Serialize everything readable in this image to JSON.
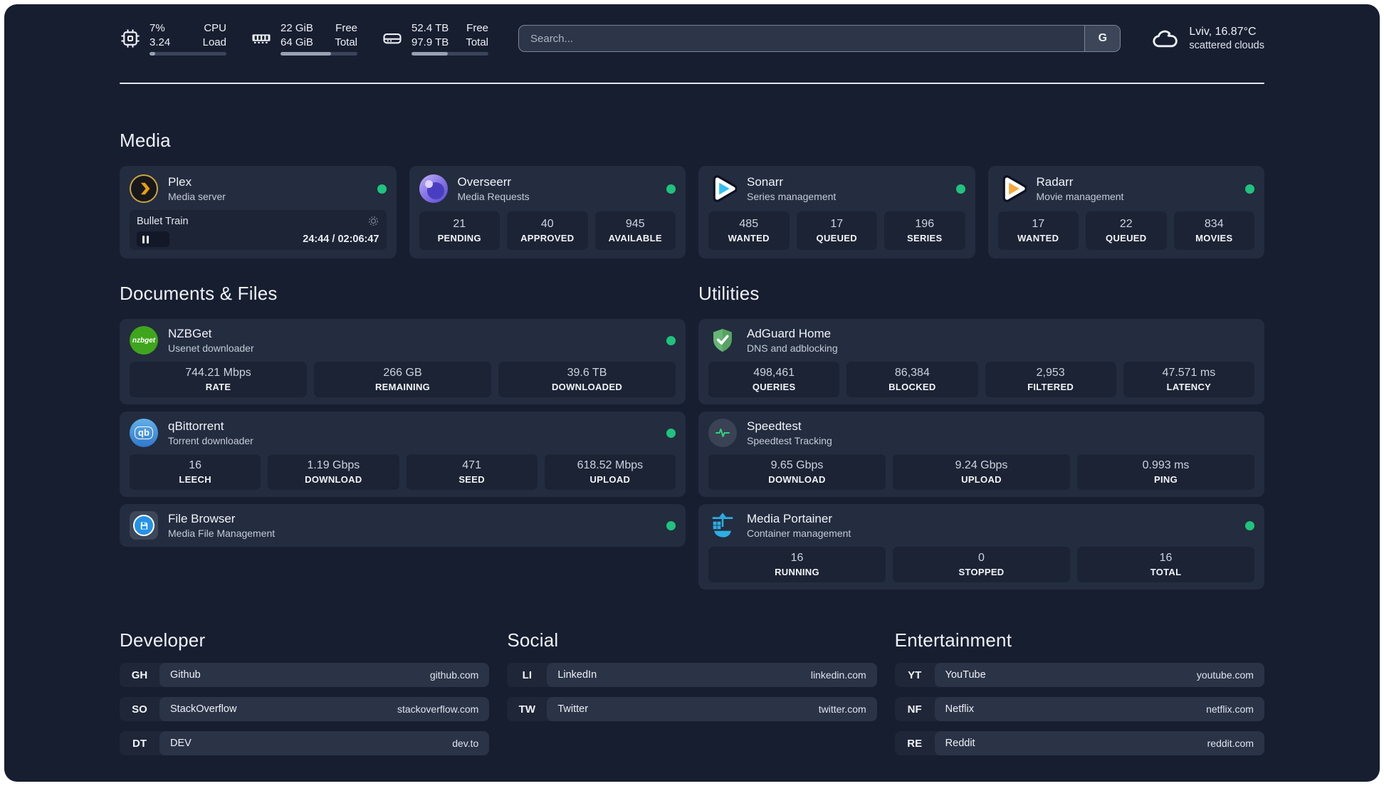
{
  "colors": {
    "status_online": "#1fc37d",
    "accent_plex": "#e8a00c",
    "accent_sonarr": "#31c1f2",
    "accent_radarr": "#f6a83a",
    "accent_nzbget": "#3fa51c",
    "accent_filebrowser": "#2492e8",
    "accent_adguard": "#66b574",
    "accent_speedtest": "#2ed47f",
    "accent_portainer": "#2caee4"
  },
  "topbar": {
    "cpu": {
      "value_top": "7%",
      "value_bottom": "3.24",
      "label_top": "CPU",
      "label_bottom": "Load",
      "progress_style": "width:7%"
    },
    "memory": {
      "value_top": "22 GiB",
      "value_bottom": "64 GiB",
      "label_top": "Free",
      "label_bottom": "Total",
      "progress_style": "width:66%"
    },
    "disk": {
      "value_top": "52.4 TB",
      "value_bottom": "97.9 TB",
      "label_top": "Free",
      "label_bottom": "Total",
      "progress_style": "width:47%"
    },
    "search": {
      "placeholder": "Search...",
      "button_label": "G"
    },
    "weather": {
      "location": "Lviv, 16.87°C",
      "condition": "scattered clouds"
    }
  },
  "media": {
    "title": "Media",
    "plex": {
      "title": "Plex",
      "subtitle": "Media server",
      "player": {
        "track": "Bullet Train",
        "time": "24:44 / 02:06:47"
      }
    },
    "overseerr": {
      "title": "Overseerr",
      "subtitle": "Media Requests",
      "stats": [
        {
          "value": "21",
          "label": "PENDING"
        },
        {
          "value": "40",
          "label": "APPROVED"
        },
        {
          "value": "945",
          "label": "AVAILABLE"
        }
      ]
    },
    "sonarr": {
      "title": "Sonarr",
      "subtitle": "Series management",
      "stats": [
        {
          "value": "485",
          "label": "WANTED"
        },
        {
          "value": "17",
          "label": "QUEUED"
        },
        {
          "value": "196",
          "label": "SERIES"
        }
      ]
    },
    "radarr": {
      "title": "Radarr",
      "subtitle": "Movie management",
      "stats": [
        {
          "value": "17",
          "label": "WANTED"
        },
        {
          "value": "22",
          "label": "QUEUED"
        },
        {
          "value": "834",
          "label": "MOVIES"
        }
      ]
    }
  },
  "documents": {
    "title": "Documents & Files",
    "nzbget": {
      "title": "NZBGet",
      "subtitle": "Usenet downloader",
      "icon_text": "nzbget",
      "stats": [
        {
          "value": "744.21 Mbps",
          "label": "RATE"
        },
        {
          "value": "266 GB",
          "label": "REMAINING"
        },
        {
          "value": "39.6 TB",
          "label": "DOWNLOADED"
        }
      ]
    },
    "qbittorrent": {
      "title": "qBittorrent",
      "subtitle": "Torrent downloader",
      "icon_text": "qb",
      "stats": [
        {
          "value": "16",
          "label": "LEECH"
        },
        {
          "value": "1.19 Gbps",
          "label": "DOWNLOAD"
        },
        {
          "value": "471",
          "label": "SEED"
        },
        {
          "value": "618.52 Mbps",
          "label": "UPLOAD"
        }
      ]
    },
    "filebrowser": {
      "title": "File Browser",
      "subtitle": "Media File Management"
    }
  },
  "utilities": {
    "title": "Utilities",
    "adguard": {
      "title": "AdGuard Home",
      "subtitle": "DNS and adblocking",
      "stats": [
        {
          "value": "498,461",
          "label": "QUERIES"
        },
        {
          "value": "86,384",
          "label": "BLOCKED"
        },
        {
          "value": "2,953",
          "label": "FILTERED"
        },
        {
          "value": "47.571 ms",
          "label": "LATENCY"
        }
      ]
    },
    "speedtest": {
      "title": "Speedtest",
      "subtitle": "Speedtest Tracking",
      "stats": [
        {
          "value": "9.65 Gbps",
          "label": "DOWNLOAD"
        },
        {
          "value": "9.24 Gbps",
          "label": "UPLOAD"
        },
        {
          "value": "0.993 ms",
          "label": "PING"
        }
      ]
    },
    "portainer": {
      "title": "Media Portainer",
      "subtitle": "Container management",
      "stats": [
        {
          "value": "16",
          "label": "RUNNING"
        },
        {
          "value": "0",
          "label": "STOPPED"
        },
        {
          "value": "16",
          "label": "TOTAL"
        }
      ]
    }
  },
  "bookmarks": {
    "developer": {
      "title": "Developer",
      "items": [
        {
          "abbr": "GH",
          "name": "Github",
          "url": "github.com"
        },
        {
          "abbr": "SO",
          "name": "StackOverflow",
          "url": "stackoverflow.com"
        },
        {
          "abbr": "DT",
          "name": "DEV",
          "url": "dev.to"
        }
      ]
    },
    "social": {
      "title": "Social",
      "items": [
        {
          "abbr": "LI",
          "name": "LinkedIn",
          "url": "linkedin.com"
        },
        {
          "abbr": "TW",
          "name": "Twitter",
          "url": "twitter.com"
        }
      ]
    },
    "entertainment": {
      "title": "Entertainment",
      "items": [
        {
          "abbr": "YT",
          "name": "YouTube",
          "url": "youtube.com"
        },
        {
          "abbr": "NF",
          "name": "Netflix",
          "url": "netflix.com"
        },
        {
          "abbr": "RE",
          "name": "Reddit",
          "url": "reddit.com"
        }
      ]
    }
  }
}
